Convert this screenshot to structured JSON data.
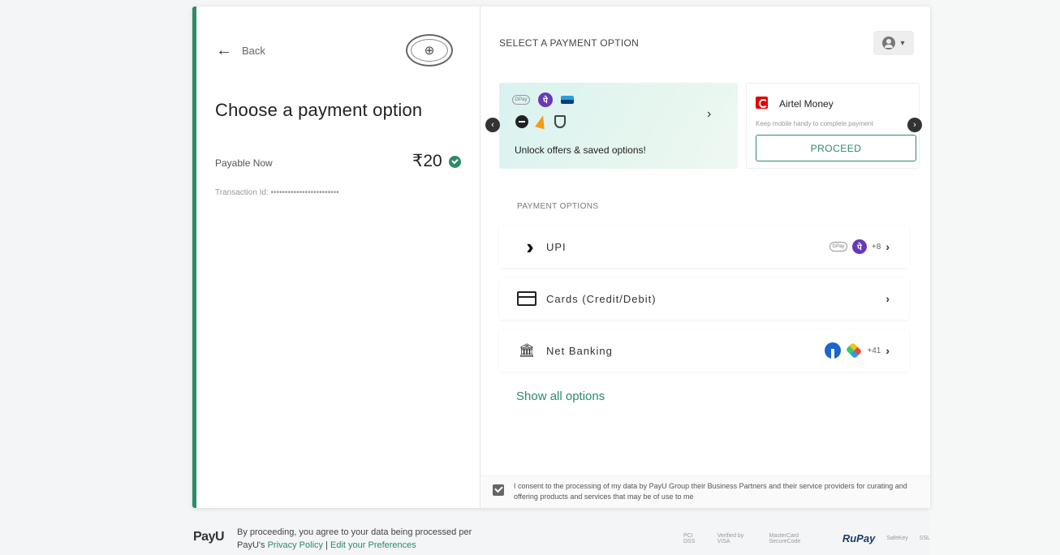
{
  "left_panel": {
    "back_label": "Back",
    "title": "Choose a payment option",
    "payable_label": "Payable Now",
    "amount": "₹20",
    "transaction_label": "Transaction Id: ••••••••••••••••••••••••"
  },
  "right_panel": {
    "header": "SELECT A PAYMENT OPTION",
    "offer_card": {
      "text": "Unlock offers & saved options!",
      "icons": [
        "gpay-icon",
        "phonepe-icon",
        "paytm-icon",
        "wallet-icon",
        "amazon-pay-icon",
        "shield-icon"
      ]
    },
    "airtel": {
      "name": "Airtel Money",
      "hint": "Keep mobile handy to complete payment",
      "button": "PROCEED"
    },
    "options_header": "PAYMENT OPTIONS",
    "options": [
      {
        "label": "UPI",
        "more": "+8"
      },
      {
        "label": "Cards (Credit/Debit)",
        "more": ""
      },
      {
        "label": "Net Banking",
        "more": "+41"
      }
    ],
    "show_all": "Show all options",
    "consent": "I consent to the processing of my data by PayU Group their Business Partners and their service providers for curating and offering products and services that may be of use to me"
  },
  "footer": {
    "brand": "PayU",
    "line1": "By proceeding, you agree to your data being processed per",
    "line2_prefix": "PayU's ",
    "privacy_link": "Privacy Policy",
    "separator": " | ",
    "prefs_link": "Edit your Preferences",
    "badges": [
      "PCI DSS",
      "Verified by VISA",
      "MasterCard SecureCode",
      "RuPay",
      "SafeKey",
      "SSL"
    ]
  },
  "colors": {
    "accent": "#2e8b68",
    "phonepe": "#6739b7",
    "airtel": "#e40000"
  }
}
